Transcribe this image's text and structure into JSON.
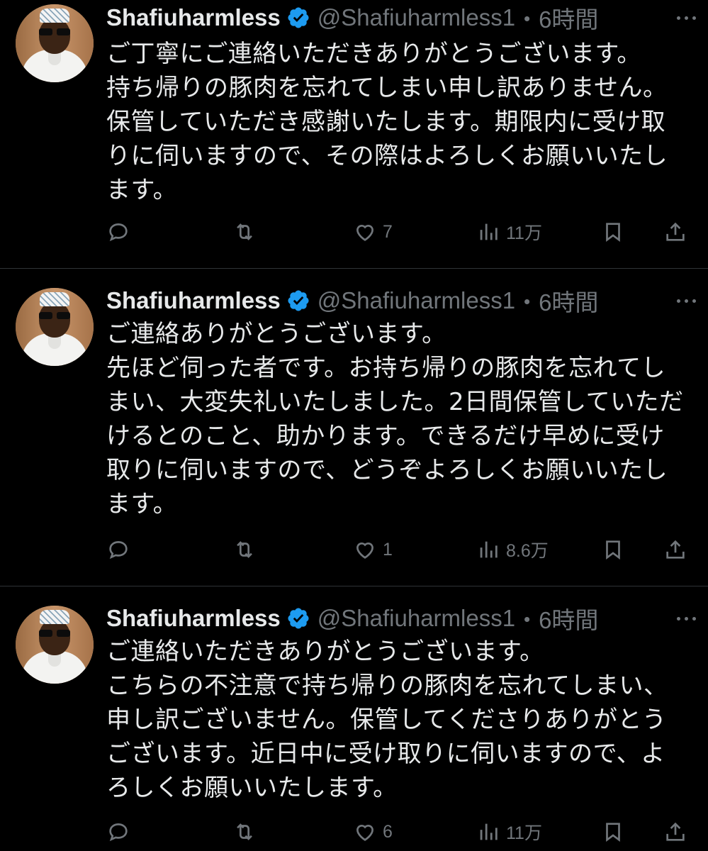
{
  "tweets": [
    {
      "author": {
        "name": "Shafiuharmless",
        "handle": "@Shafiuharmless1",
        "time": "・6時間"
      },
      "lines": [
        "ご丁寧にご連絡いただきありがとうございます。",
        "持ち帰りの豚肉を忘れてしまい申し訳ありません。",
        "保管していただき感謝いたします。期限内に受け取",
        "りに伺いますので、その際はよろしくお願いいたし",
        "ます。"
      ],
      "actions": {
        "reply": "",
        "retweet": "",
        "like": "7",
        "views": "11万"
      }
    },
    {
      "author": {
        "name": "Shafiuharmless",
        "handle": "@Shafiuharmless1",
        "time": "・6時間"
      },
      "lines": [
        "ご連絡ありがとうございます。",
        "先ほど伺った者です。お持ち帰りの豚肉を忘れてし",
        "まい、大変失礼いたしました。2日間保管していただ",
        "けるとのこと、助かります。できるだけ早めに受け",
        "取りに伺いますので、どうぞよろしくお願いいたし",
        "ます。"
      ],
      "actions": {
        "reply": "",
        "retweet": "",
        "like": "1",
        "views": "8.6万"
      }
    },
    {
      "author": {
        "name": "Shafiuharmless",
        "handle": "@Shafiuharmless1",
        "time": "・6時間"
      },
      "lines": [
        "ご連絡いただきありがとうございます。",
        "こちらの不注意で持ち帰りの豚肉を忘れてしまい、",
        "申し訳ございません。保管してくださりありがとう",
        "ございます。近日中に受け取りに伺いますので、よ",
        "ろしくお願いいたします。"
      ],
      "actions": {
        "reply": "",
        "retweet": "",
        "like": "6",
        "views": "11万"
      }
    }
  ],
  "icons": {
    "verified": "verified-badge-icon",
    "reply": "reply-bubble-icon",
    "retweet": "retweet-icon",
    "like": "heart-icon",
    "views": "views-bar-chart-icon",
    "bookmark": "bookmark-icon",
    "share": "share-upload-icon",
    "more": "more-dots-icon"
  },
  "colors": {
    "background": "#000000",
    "text": "#e7e9ea",
    "muted": "#71767b",
    "verified": "#1d9bf0",
    "divider": "#2f3336"
  }
}
